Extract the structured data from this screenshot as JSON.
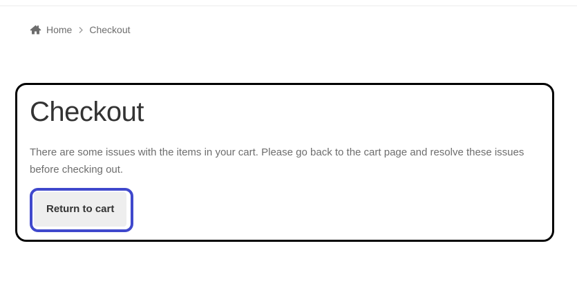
{
  "breadcrumb": {
    "home_icon": "home-icon",
    "home_label": "Home",
    "separator_icon": "chevron-right-icon",
    "current_label": "Checkout"
  },
  "page": {
    "title": "Checkout",
    "message": "There are some issues with the items in your cart. Please go back to the cart page and resolve these issues before checking out."
  },
  "actions": {
    "return_label": "Return to cart"
  },
  "colors": {
    "text": "#6d6d6d",
    "heading": "#333333",
    "button_bg": "#eeeeee",
    "highlight_outline": "#3f48cc",
    "card_outline": "#000000"
  }
}
